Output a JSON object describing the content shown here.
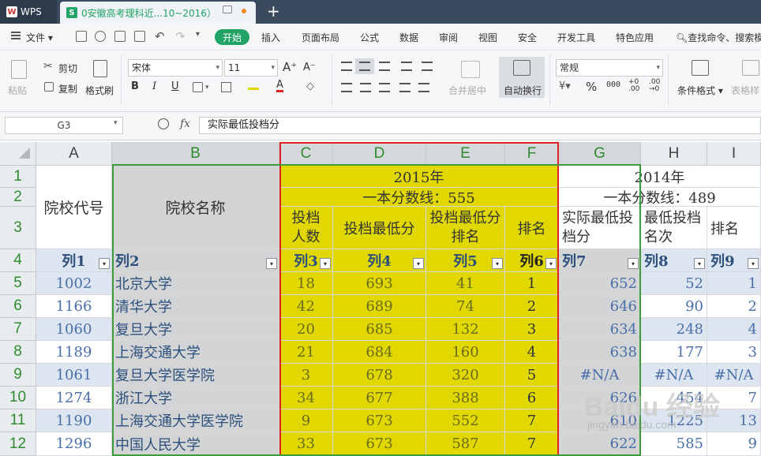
{
  "app": {
    "name": "WPS",
    "doc_tab_title": "0安徽高考理科近...10~2016）"
  },
  "menu": {
    "file": "文件",
    "items": [
      "开始",
      "插入",
      "页面布局",
      "公式",
      "数据",
      "审阅",
      "视图",
      "安全",
      "开发工具",
      "特色应用"
    ],
    "search": "查找命令、搜索模"
  },
  "ribbon": {
    "paste": "粘贴",
    "cut": "剪切",
    "copy": "复制",
    "format_painter": "格式刷",
    "font_name": "宋体",
    "font_size": "11",
    "merge_center": "合并居中",
    "wrap_text": "自动换行",
    "number_format": "常规",
    "conditional_format": "条件格式",
    "table_style": "表格样",
    "percent_symbol": "%",
    "thousands_symbol": "000"
  },
  "formula_bar": {
    "name_box": "G3",
    "fx": "fx",
    "content": "实际最低投档分"
  },
  "sheet": {
    "columns": [
      "A",
      "B",
      "C",
      "D",
      "E",
      "F",
      "G",
      "H",
      "I"
    ],
    "rows": [
      "1",
      "2",
      "3",
      "4",
      "5",
      "6",
      "7",
      "8",
      "9",
      "10",
      "11",
      "12"
    ],
    "header": {
      "a13": "院校代号",
      "b13": "院校名称",
      "year_2015": "2015年",
      "line_2015": "一本分数线：555",
      "year_2014": "2014年",
      "line_2014": "一本分数线：489",
      "c3": "投档人数",
      "d3": "投档最低分",
      "e3": "投档最低分排名",
      "f3": "排名",
      "g3": "实际最低投档分",
      "h3": "最低投档名次",
      "i3": "排名"
    },
    "filter_row": [
      "列1",
      "列2",
      "列3",
      "列4",
      "列5",
      "列6",
      "列7",
      "列8",
      "列9"
    ],
    "data": [
      [
        "1002",
        "北京大学",
        "18",
        "693",
        "41",
        "1",
        "652",
        "52",
        "1"
      ],
      [
        "1166",
        "清华大学",
        "42",
        "689",
        "74",
        "2",
        "646",
        "90",
        "2"
      ],
      [
        "1060",
        "复旦大学",
        "20",
        "685",
        "132",
        "3",
        "634",
        "248",
        "4"
      ],
      [
        "1189",
        "上海交通大学",
        "21",
        "684",
        "160",
        "4",
        "638",
        "177",
        "3"
      ],
      [
        "1061",
        "复旦大学医学院",
        "3",
        "678",
        "320",
        "5",
        "#N/A",
        "#N/A",
        "#N/A"
      ],
      [
        "1274",
        "浙江大学",
        "34",
        "677",
        "388",
        "6",
        "626",
        "454",
        "7"
      ],
      [
        "1190",
        "上海交通大学医学院",
        "9",
        "673",
        "552",
        "7",
        "610",
        "1225",
        "13"
      ],
      [
        "1296",
        "中国人民大学",
        "33",
        "673",
        "587",
        "7",
        "622",
        "585",
        "9"
      ]
    ]
  },
  "watermark": {
    "main": "Baidu 经验",
    "sub": "jingyan.baidu.com"
  },
  "colors": {
    "accent_green": "#21a366",
    "highlight_yellow": "#e0d800",
    "selection_red": "#e02020",
    "table_green_border": "#3c9c3c"
  }
}
